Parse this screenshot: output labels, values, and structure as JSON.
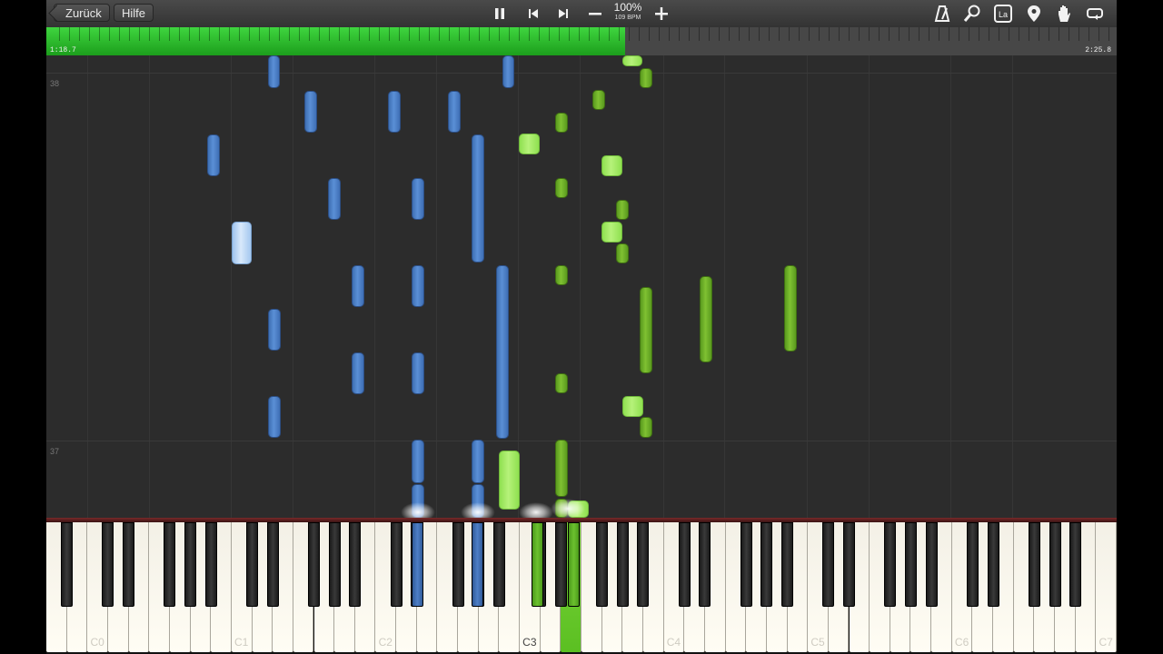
{
  "toolbar": {
    "back_label": "Zurück",
    "help_label": "Hilfe",
    "speed_percent": "100%",
    "bpm": "109 BPM",
    "icons": [
      "pause-icon",
      "skip-back-icon",
      "skip-forward-icon",
      "minus-icon",
      "plus-icon",
      "metronome-icon",
      "search-icon",
      "la-icon",
      "location-pin-icon",
      "hand-icon",
      "loop-icon"
    ],
    "la_text": "La"
  },
  "progress": {
    "current_time": "1:18.7",
    "total_time": "2:25.8",
    "fraction": 0.541
  },
  "measures": [
    "38",
    "37"
  ],
  "colors": {
    "left_hand": "#4f80c8",
    "right_hand": "#74b72c",
    "progress": "#2fbf2f",
    "background": "#2c2c2c"
  },
  "keyboard": {
    "octave_labels": [
      "C0",
      "C1",
      "C2",
      "C3",
      "C4",
      "C5",
      "C6",
      "C7"
    ],
    "highlighted_octave": "C3"
  }
}
